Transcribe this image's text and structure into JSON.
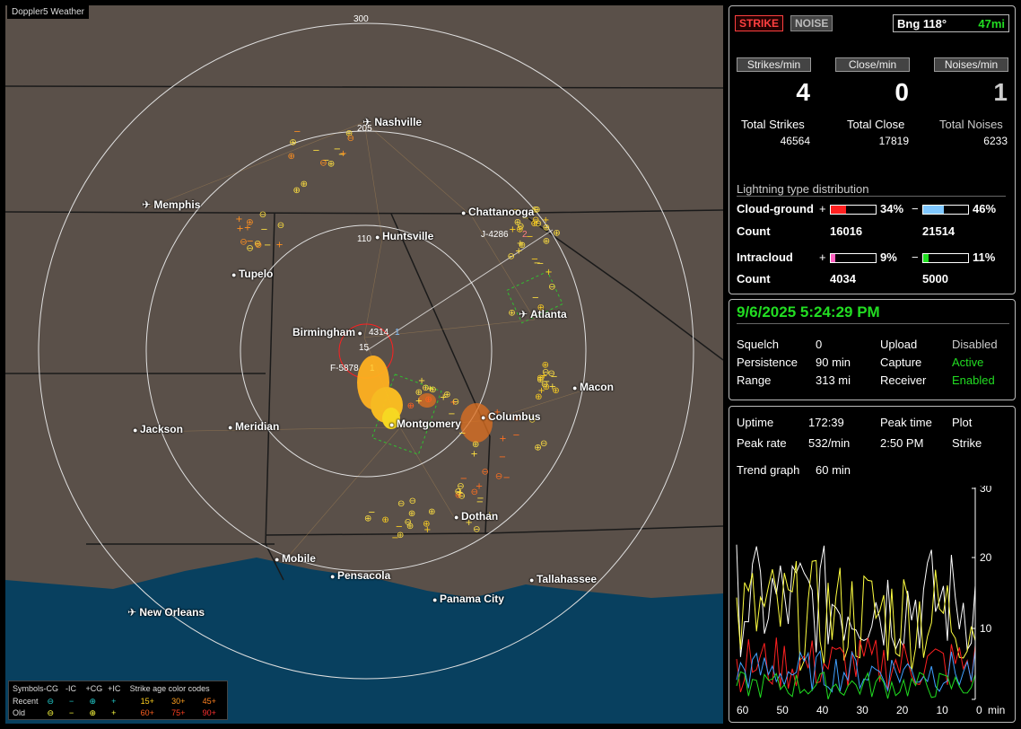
{
  "app_tag": "Doppler5 Weather",
  "cities": [
    {
      "name": "Nashville",
      "icon": "airport"
    },
    {
      "name": "Memphis",
      "icon": "airport"
    },
    {
      "name": "Chattanooga",
      "icon": "dot"
    },
    {
      "name": "Huntsville",
      "icon": "dot"
    },
    {
      "name": "Tupelo",
      "icon": "dot"
    },
    {
      "name": "Atlanta",
      "icon": "airport"
    },
    {
      "name": "Birmingham",
      "icon": "dot"
    },
    {
      "name": "Macon",
      "icon": "dot"
    },
    {
      "name": "Columbus",
      "icon": "dot"
    },
    {
      "name": "Jackson",
      "icon": "dot"
    },
    {
      "name": "Meridian",
      "icon": "dot"
    },
    {
      "name": "Montgomery",
      "icon": "dot"
    },
    {
      "name": "Dothan",
      "icon": "dot"
    },
    {
      "name": "Mobile",
      "icon": "dot"
    },
    {
      "name": "Pensacola",
      "icon": "dot"
    },
    {
      "name": "Tallahassee",
      "icon": "dot"
    },
    {
      "name": "Panama City",
      "icon": "dot"
    },
    {
      "name": "New Orleans",
      "icon": "airport"
    }
  ],
  "rings": [
    "300",
    "205",
    "110",
    "15"
  ],
  "storm_tags": [
    "J-4286",
    "2",
    "4314",
    "1",
    "F-5878",
    "1"
  ],
  "legend": {
    "row1": [
      "Symbols",
      "-CG",
      "-IC",
      "+CG",
      "+IC",
      "Strike age color codes"
    ],
    "recent_label": "Recent",
    "old_label": "Old",
    "recent_ages": [
      "15+",
      "30+",
      "45+"
    ],
    "old_ages": [
      "60+",
      "75+",
      "90+"
    ]
  },
  "status": {
    "strike_btn": "STRIKE",
    "noise_btn": "NOISE",
    "bearing": "Bng 118°",
    "distance": "47mi",
    "rate_headers": [
      "Strikes/min",
      "Close/min",
      "Noises/min"
    ],
    "rates": [
      "4",
      "0",
      "1"
    ],
    "totals_labels": [
      "Total Strikes",
      "Total Close",
      "Total Noises"
    ],
    "totals": [
      "46564",
      "17819",
      "6233"
    ]
  },
  "distribution": {
    "title": "Lightning type distribution",
    "cloud_ground": "Cloud-ground",
    "intracloud": "Intracloud",
    "count_label": "Count",
    "cg_pos_pct": "34%",
    "cg_neg_pct": "46%",
    "cg_pos_count": "16016",
    "cg_neg_count": "21514",
    "ic_pos_pct": "9%",
    "ic_neg_pct": "11%",
    "ic_pos_count": "4034",
    "ic_neg_count": "5000",
    "plus": "+",
    "minus": "−",
    "colors": {
      "cg_pos": "#ff2020",
      "cg_neg": "#80c8ff",
      "ic_pos": "#ff60c0",
      "ic_neg": "#20dd20"
    }
  },
  "settings": {
    "datetime": "9/6/2025 5:24:29 PM",
    "rows": [
      {
        "label": "Squelch",
        "value": "0",
        "label2": "Upload",
        "value2": "Disabled"
      },
      {
        "label": "Persistence",
        "value": "90 min",
        "label2": "Capture",
        "value2": "Active"
      },
      {
        "label": "Range",
        "value": "313 mi",
        "label2": "Receiver",
        "value2": "Enabled"
      }
    ]
  },
  "trend": {
    "uptime_label": "Uptime",
    "uptime": "172:39",
    "peak_time_label": "Peak time",
    "peak_time": "2:50 PM",
    "plot_label": "Plot",
    "plot": "Strike",
    "peak_rate_label": "Peak rate",
    "peak_rate": "532/min",
    "trend_label": "Trend graph",
    "trend_value": "60 min",
    "y_ticks": [
      "30",
      "20",
      "10"
    ],
    "x_ticks": [
      "60",
      "50",
      "40",
      "30",
      "20",
      "10",
      "0"
    ],
    "x_unit": "min"
  }
}
